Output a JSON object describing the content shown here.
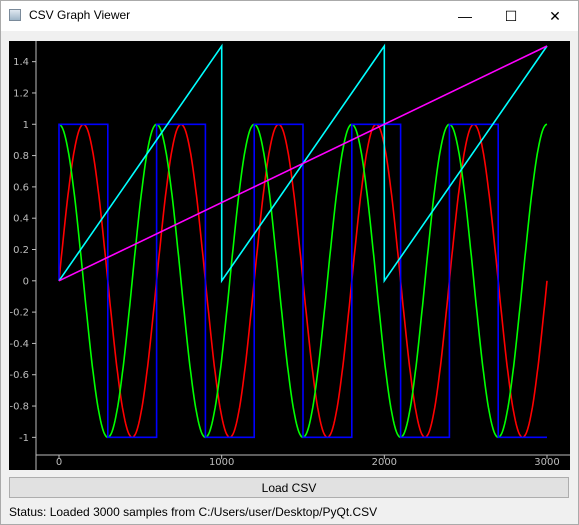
{
  "window": {
    "title": "CSV Graph Viewer",
    "minimize_glyph": "—",
    "maximize_glyph": "☐",
    "close_glyph": "✕"
  },
  "load_button": {
    "label": "Load CSV"
  },
  "status": {
    "text": "Status: Loaded 3000 samples from C:/Users/user/Desktop/PyQt.CSV"
  },
  "chart_data": {
    "type": "line",
    "samples": 3000,
    "xlim": [
      0,
      3000
    ],
    "ylim": [
      -1.1,
      1.5
    ],
    "x_ticks": [
      0,
      1000,
      2000,
      3000
    ],
    "y_ticks": [
      -1,
      -0.8,
      -0.6,
      -0.4,
      -0.2,
      0,
      0.2,
      0.4,
      0.6,
      0.8,
      1,
      1.2,
      1.4
    ],
    "background": "#000000",
    "axis_color": "#bdbdbd",
    "series": [
      {
        "color": "#ff0000",
        "shape": "sine",
        "period": 600,
        "amplitude": 1
      },
      {
        "color": "#00ff00",
        "shape": "cosine",
        "period": 600,
        "amplitude": 1
      },
      {
        "color": "#0000ff",
        "shape": "square",
        "period": 600,
        "amplitude": 1
      },
      {
        "color": "#00ffff",
        "shape": "sawtooth",
        "period": 1000,
        "peak": 1.5
      },
      {
        "color": "#ff00ff",
        "shape": "ramp",
        "x": [
          0,
          3000
        ],
        "y": [
          0,
          1.5
        ]
      }
    ]
  }
}
